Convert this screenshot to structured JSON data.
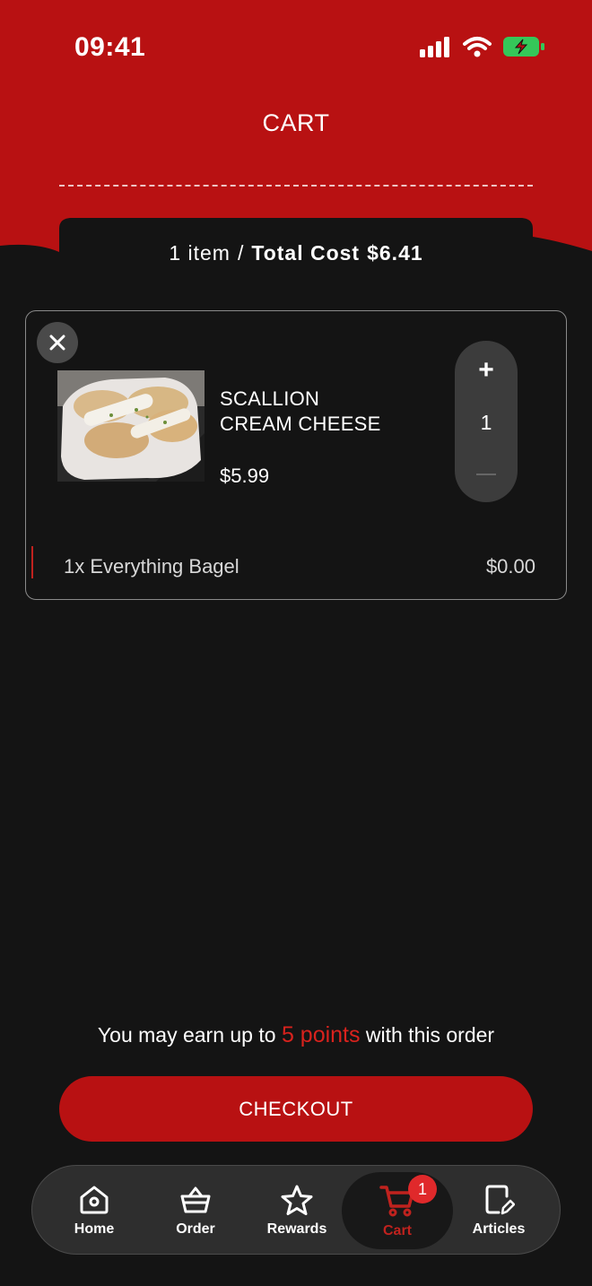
{
  "status_bar": {
    "time": "09:41"
  },
  "header": {
    "title": "CART",
    "background_color": "#b81112"
  },
  "summary": {
    "item_count": "1 item",
    "separator": "/",
    "total_label": "Total Cost",
    "total_value": "$6.41"
  },
  "cart_items": [
    {
      "name_line1": "SCALLION",
      "name_line2": "CREAM CHEESE",
      "price": "$5.99",
      "quantity": "1",
      "modifier": {
        "name": "1x Everything Bagel",
        "price": "$0.00"
      }
    }
  ],
  "points": {
    "prefix": "You may earn up to",
    "value": "5 points",
    "suffix": "with this order",
    "accent_color": "#d9221d"
  },
  "checkout": {
    "label": "CHECKOUT"
  },
  "nav": {
    "items": [
      {
        "label": "Home",
        "icon": "home-icon"
      },
      {
        "label": "Order",
        "icon": "basket-icon"
      },
      {
        "label": "Rewards",
        "icon": "star-icon"
      },
      {
        "label": "Cart",
        "icon": "cart-icon",
        "badge": "1",
        "active": true
      },
      {
        "label": "Articles",
        "icon": "edit-document-icon"
      }
    ]
  }
}
